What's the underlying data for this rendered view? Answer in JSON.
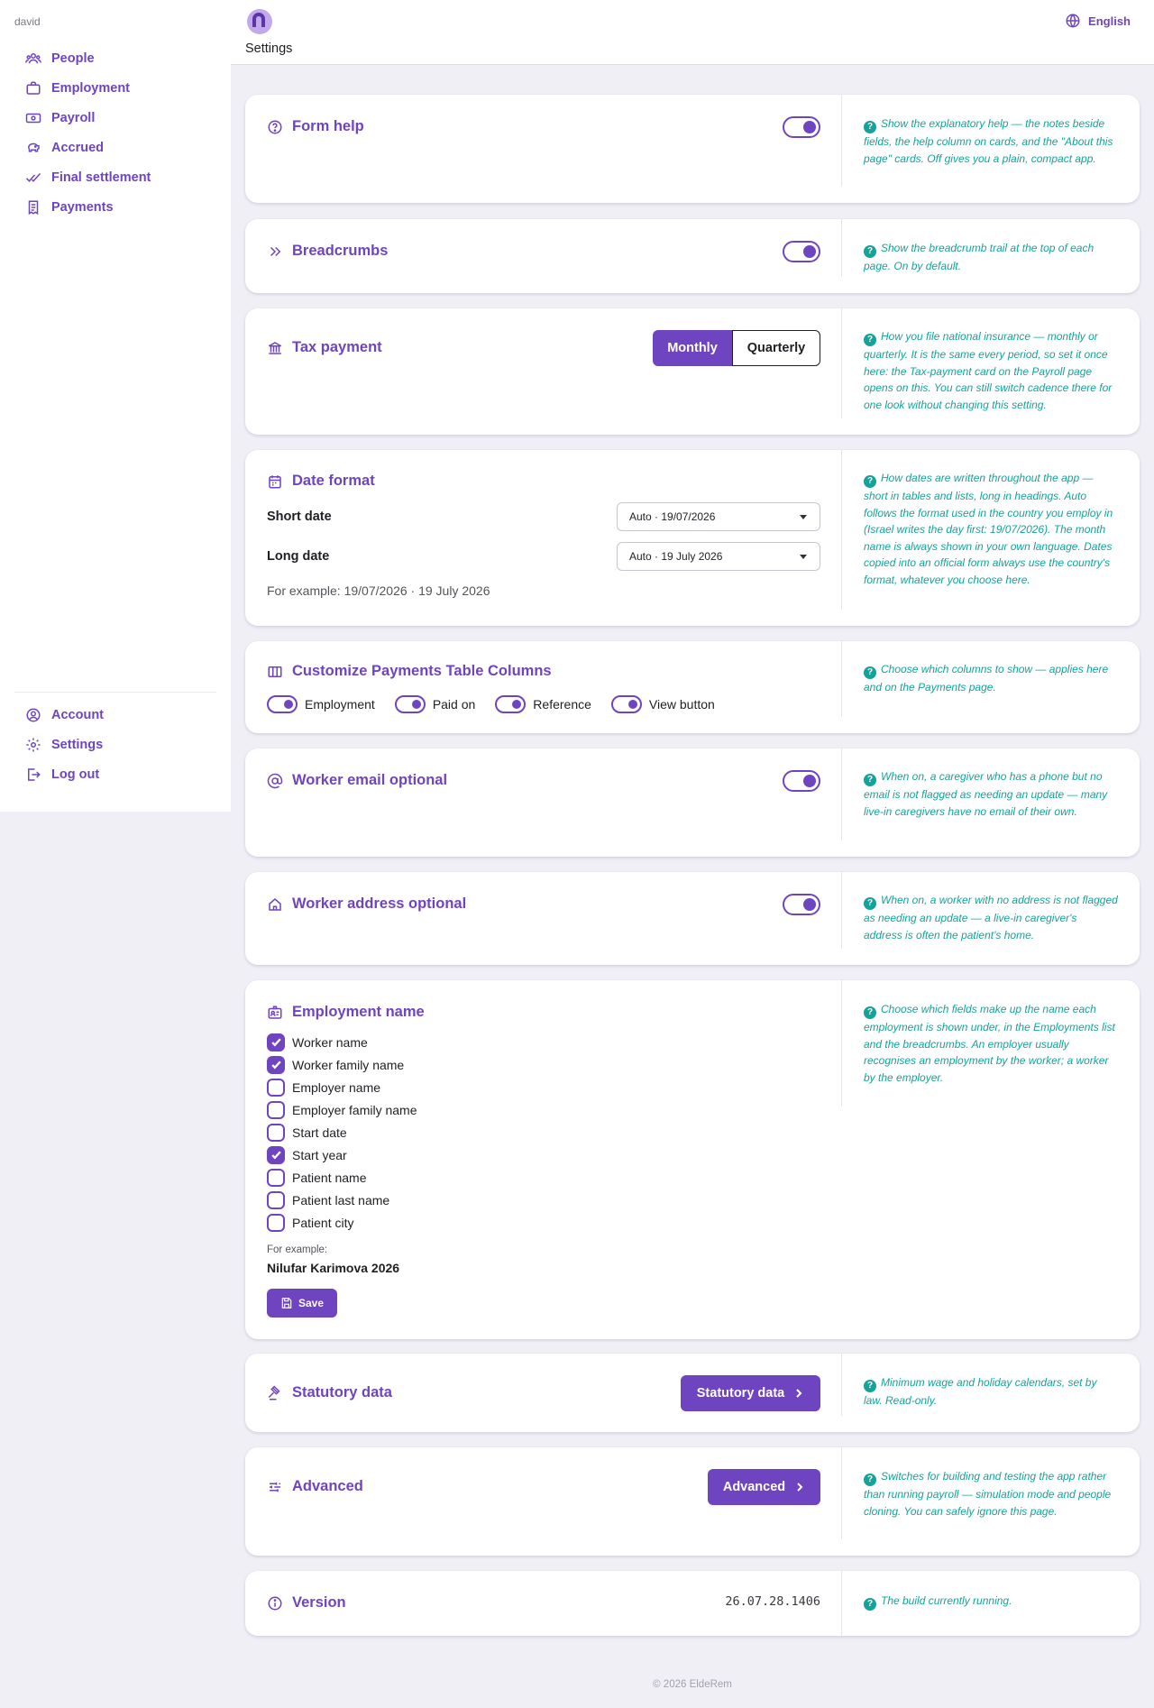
{
  "sidebar": {
    "user": "david",
    "nav": [
      "People",
      "Employment",
      "Payroll",
      "Accrued",
      "Final settlement",
      "Payments"
    ],
    "account": [
      "Account",
      "Settings",
      "Log out"
    ]
  },
  "header": {
    "title": "Settings",
    "language": "English"
  },
  "cards": {
    "form_help": {
      "title": "Form help",
      "enabled": true,
      "help": "Show the explanatory help — the notes beside fields, the help column on cards, and the \"About this page\" cards. Off gives you a plain, compact app."
    },
    "breadcrumbs": {
      "title": "Breadcrumbs",
      "enabled": true,
      "help": "Show the breadcrumb trail at the top of each page. On by default."
    },
    "tax_payment": {
      "title": "Tax payment",
      "options": [
        "Monthly",
        "Quarterly"
      ],
      "selected": "Monthly",
      "help": "How you file national insurance — monthly or quarterly. It is the same every period, so set it once here: the Tax-payment card on the Payroll page opens on this. You can still switch cadence there for one look without changing this setting."
    },
    "date_format": {
      "title": "Date format",
      "short_label": "Short date",
      "short_value": "Auto · 19/07/2026",
      "long_label": "Long date",
      "long_value": "Auto · 19 July 2026",
      "example": "For example: 19/07/2026 · 19 July 2026",
      "help": "How dates are written throughout the app — short in tables and lists, long in headings. Auto follows the format used in the country you employ in (Israel writes the day first: 19/07/2026). The month name is always shown in your own language. Dates copied into an official form always use the country's format, whatever you choose here."
    },
    "payments_columns": {
      "title": "Customize Payments Table Columns",
      "columns": [
        "Employment",
        "Paid on",
        "Reference",
        "View button"
      ],
      "help": "Choose which columns to show — applies here and on the Payments page."
    },
    "worker_email": {
      "title": "Worker email optional",
      "enabled": true,
      "help": "When on, a caregiver who has a phone but no email is not flagged as needing an update — many live-in caregivers have no email of their own."
    },
    "worker_address": {
      "title": "Worker address optional",
      "enabled": true,
      "help": "When on, a worker with no address is not flagged as needing an update — a live-in caregiver's address is often the patient's home."
    },
    "employment_name": {
      "title": "Employment name",
      "fields": [
        {
          "label": "Worker name",
          "checked": true
        },
        {
          "label": "Worker family name",
          "checked": true
        },
        {
          "label": "Employer name",
          "checked": false
        },
        {
          "label": "Employer family name",
          "checked": false
        },
        {
          "label": "Start date",
          "checked": false
        },
        {
          "label": "Start year",
          "checked": true
        },
        {
          "label": "Patient name",
          "checked": false
        },
        {
          "label": "Patient last name",
          "checked": false
        },
        {
          "label": "Patient city",
          "checked": false
        }
      ],
      "example_label": "For example:",
      "example_value": "Nilufar Karimova 2026",
      "save": "Save",
      "help": "Choose which fields make up the name each employment is shown under, in the Employments list and the breadcrumbs. An employer usually recognises an employment by the worker; a worker by the employer."
    },
    "statutory": {
      "title": "Statutory data",
      "button": "Statutory data",
      "help": "Minimum wage and holiday calendars, set by law. Read-only."
    },
    "advanced": {
      "title": "Advanced",
      "button": "Advanced",
      "help": "Switches for building and testing the app rather than running payroll — simulation mode and people cloning. You can safely ignore this page."
    },
    "version": {
      "title": "Version",
      "value": "26.07.28.1406",
      "help": "The build currently running."
    }
  },
  "footer": "© 2026 EldeRem",
  "colors": {
    "accent": "#6f44c0",
    "help": "#14a39a",
    "background": "#f1eff6"
  }
}
